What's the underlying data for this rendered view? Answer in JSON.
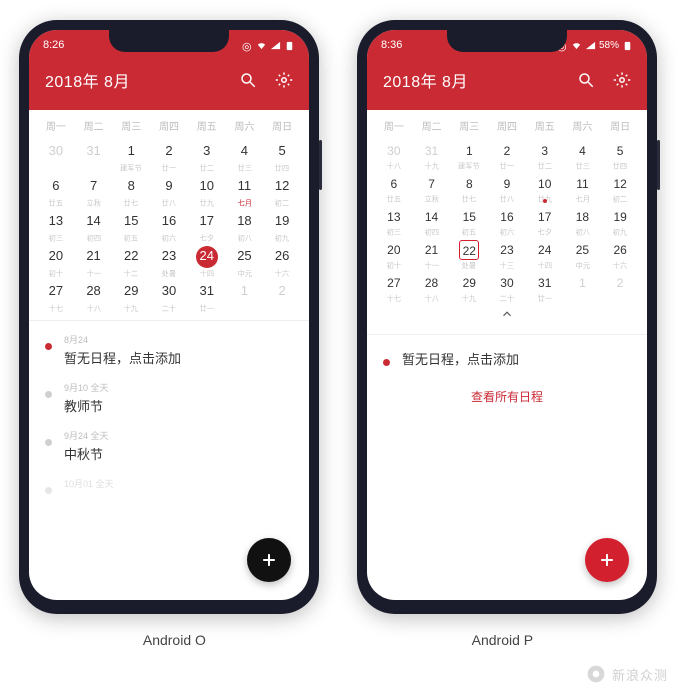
{
  "watermark": "新浪众测",
  "phones": [
    {
      "caption": "Android O",
      "status": {
        "time": "8:26",
        "battery_pct": ""
      },
      "title": "2018年  8月",
      "dow": [
        "周一",
        "周二",
        "周三",
        "周四",
        "周五",
        "周六",
        "周日"
      ],
      "weeks": [
        [
          {
            "n": "30",
            "sub": "",
            "dim": true
          },
          {
            "n": "31",
            "sub": "",
            "dim": true
          },
          {
            "n": "1",
            "sub": "建军节"
          },
          {
            "n": "2",
            "sub": "廿一"
          },
          {
            "n": "3",
            "sub": "廿二"
          },
          {
            "n": "4",
            "sub": "廿三"
          },
          {
            "n": "5",
            "sub": "廿四"
          }
        ],
        [
          {
            "n": "6",
            "sub": "廿五"
          },
          {
            "n": "7",
            "sub": "立秋"
          },
          {
            "n": "8",
            "sub": "廿七"
          },
          {
            "n": "9",
            "sub": "廿八"
          },
          {
            "n": "10",
            "sub": "廿九"
          },
          {
            "n": "11",
            "sub": "七月",
            "mark": true
          },
          {
            "n": "12",
            "sub": "初二"
          }
        ],
        [
          {
            "n": "13",
            "sub": "初三"
          },
          {
            "n": "14",
            "sub": "初四"
          },
          {
            "n": "15",
            "sub": "初五"
          },
          {
            "n": "16",
            "sub": "初六"
          },
          {
            "n": "17",
            "sub": "七夕"
          },
          {
            "n": "18",
            "sub": "初八"
          },
          {
            "n": "19",
            "sub": "初九"
          }
        ],
        [
          {
            "n": "20",
            "sub": "初十"
          },
          {
            "n": "21",
            "sub": "十一"
          },
          {
            "n": "22",
            "sub": "十二"
          },
          {
            "n": "23",
            "sub": "处暑"
          },
          {
            "n": "24",
            "sub": "十四",
            "today": "circle"
          },
          {
            "n": "25",
            "sub": "中元"
          },
          {
            "n": "26",
            "sub": "十六"
          }
        ],
        [
          {
            "n": "27",
            "sub": "十七"
          },
          {
            "n": "28",
            "sub": "十八"
          },
          {
            "n": "29",
            "sub": "十九"
          },
          {
            "n": "30",
            "sub": "二十"
          },
          {
            "n": "31",
            "sub": "廿一"
          },
          {
            "n": "1",
            "sub": "",
            "dim": true
          },
          {
            "n": "2",
            "sub": "",
            "dim": true
          }
        ]
      ],
      "events": [
        {
          "meta": "8月24",
          "label": "暂无日程，点击添加",
          "bullet": "red"
        },
        {
          "meta": "9月10 全天",
          "label": "教师节",
          "bullet": "grey"
        },
        {
          "meta": "9月24 全天",
          "label": "中秋节",
          "bullet": "grey"
        },
        {
          "meta": "10月01 全天",
          "label": "",
          "bullet": "grey"
        }
      ],
      "fab_color": "black"
    },
    {
      "caption": "Android P",
      "status": {
        "time": "8:36",
        "battery_pct": "58%"
      },
      "title": "2018年  8月",
      "dow": [
        "周一",
        "周二",
        "周三",
        "周四",
        "周五",
        "周六",
        "周日"
      ],
      "weeks": [
        [
          {
            "n": "30",
            "sub": "十八",
            "dim": true
          },
          {
            "n": "31",
            "sub": "十九",
            "dim": true
          },
          {
            "n": "1",
            "sub": "建军节"
          },
          {
            "n": "2",
            "sub": "廿一"
          },
          {
            "n": "3",
            "sub": "廿二"
          },
          {
            "n": "4",
            "sub": "廿三"
          },
          {
            "n": "5",
            "sub": "廿四"
          }
        ],
        [
          {
            "n": "6",
            "sub": "廿五"
          },
          {
            "n": "7",
            "sub": "立秋"
          },
          {
            "n": "8",
            "sub": "廿七"
          },
          {
            "n": "9",
            "sub": "廿八"
          },
          {
            "n": "10",
            "sub": "廿九",
            "dot": true
          },
          {
            "n": "11",
            "sub": "七月"
          },
          {
            "n": "12",
            "sub": "初二"
          }
        ],
        [
          {
            "n": "13",
            "sub": "初三"
          },
          {
            "n": "14",
            "sub": "初四"
          },
          {
            "n": "15",
            "sub": "初五"
          },
          {
            "n": "16",
            "sub": "初六"
          },
          {
            "n": "17",
            "sub": "七夕"
          },
          {
            "n": "18",
            "sub": "初八"
          },
          {
            "n": "19",
            "sub": "初九"
          }
        ],
        [
          {
            "n": "20",
            "sub": "初十"
          },
          {
            "n": "21",
            "sub": "十一"
          },
          {
            "n": "22",
            "sub": "处暑",
            "today": "box"
          },
          {
            "n": "23",
            "sub": "十三"
          },
          {
            "n": "24",
            "sub": "十四"
          },
          {
            "n": "25",
            "sub": "中元"
          },
          {
            "n": "26",
            "sub": "十六"
          }
        ],
        [
          {
            "n": "27",
            "sub": "十七"
          },
          {
            "n": "28",
            "sub": "十八"
          },
          {
            "n": "29",
            "sub": "十九"
          },
          {
            "n": "30",
            "sub": "二十"
          },
          {
            "n": "31",
            "sub": "廿一"
          },
          {
            "n": "1",
            "sub": "",
            "dim": true
          },
          {
            "n": "2",
            "sub": "",
            "dim": true
          }
        ]
      ],
      "empty_event": {
        "label": "暂无日程，点击添加"
      },
      "view_all": "查看所有日程",
      "fab_color": "red"
    }
  ]
}
